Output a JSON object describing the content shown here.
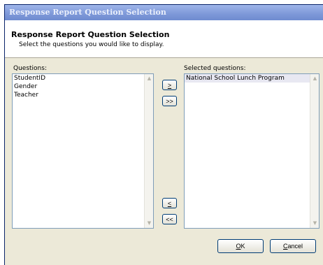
{
  "window": {
    "title": "Response Report Question Selection"
  },
  "header": {
    "title": "Response Report Question Selection",
    "subtitle": "Select the questions you would like to display."
  },
  "questions": {
    "label": "Questions:",
    "items": [
      "StudentID",
      "Gender",
      "Teacher"
    ]
  },
  "selected": {
    "label": "Selected questions:",
    "items": [
      "National School Lunch Program"
    ]
  },
  "buttons": {
    "add_one": ">",
    "add_all": ">>",
    "remove_one": "<",
    "remove_all": "<<",
    "ok_accel": "O",
    "ok_rest": "K",
    "cancel_accel": "C",
    "cancel_rest": "ancel"
  },
  "icons": {
    "scroll_up": "up-arrow-icon",
    "scroll_down": "down-arrow-icon"
  }
}
